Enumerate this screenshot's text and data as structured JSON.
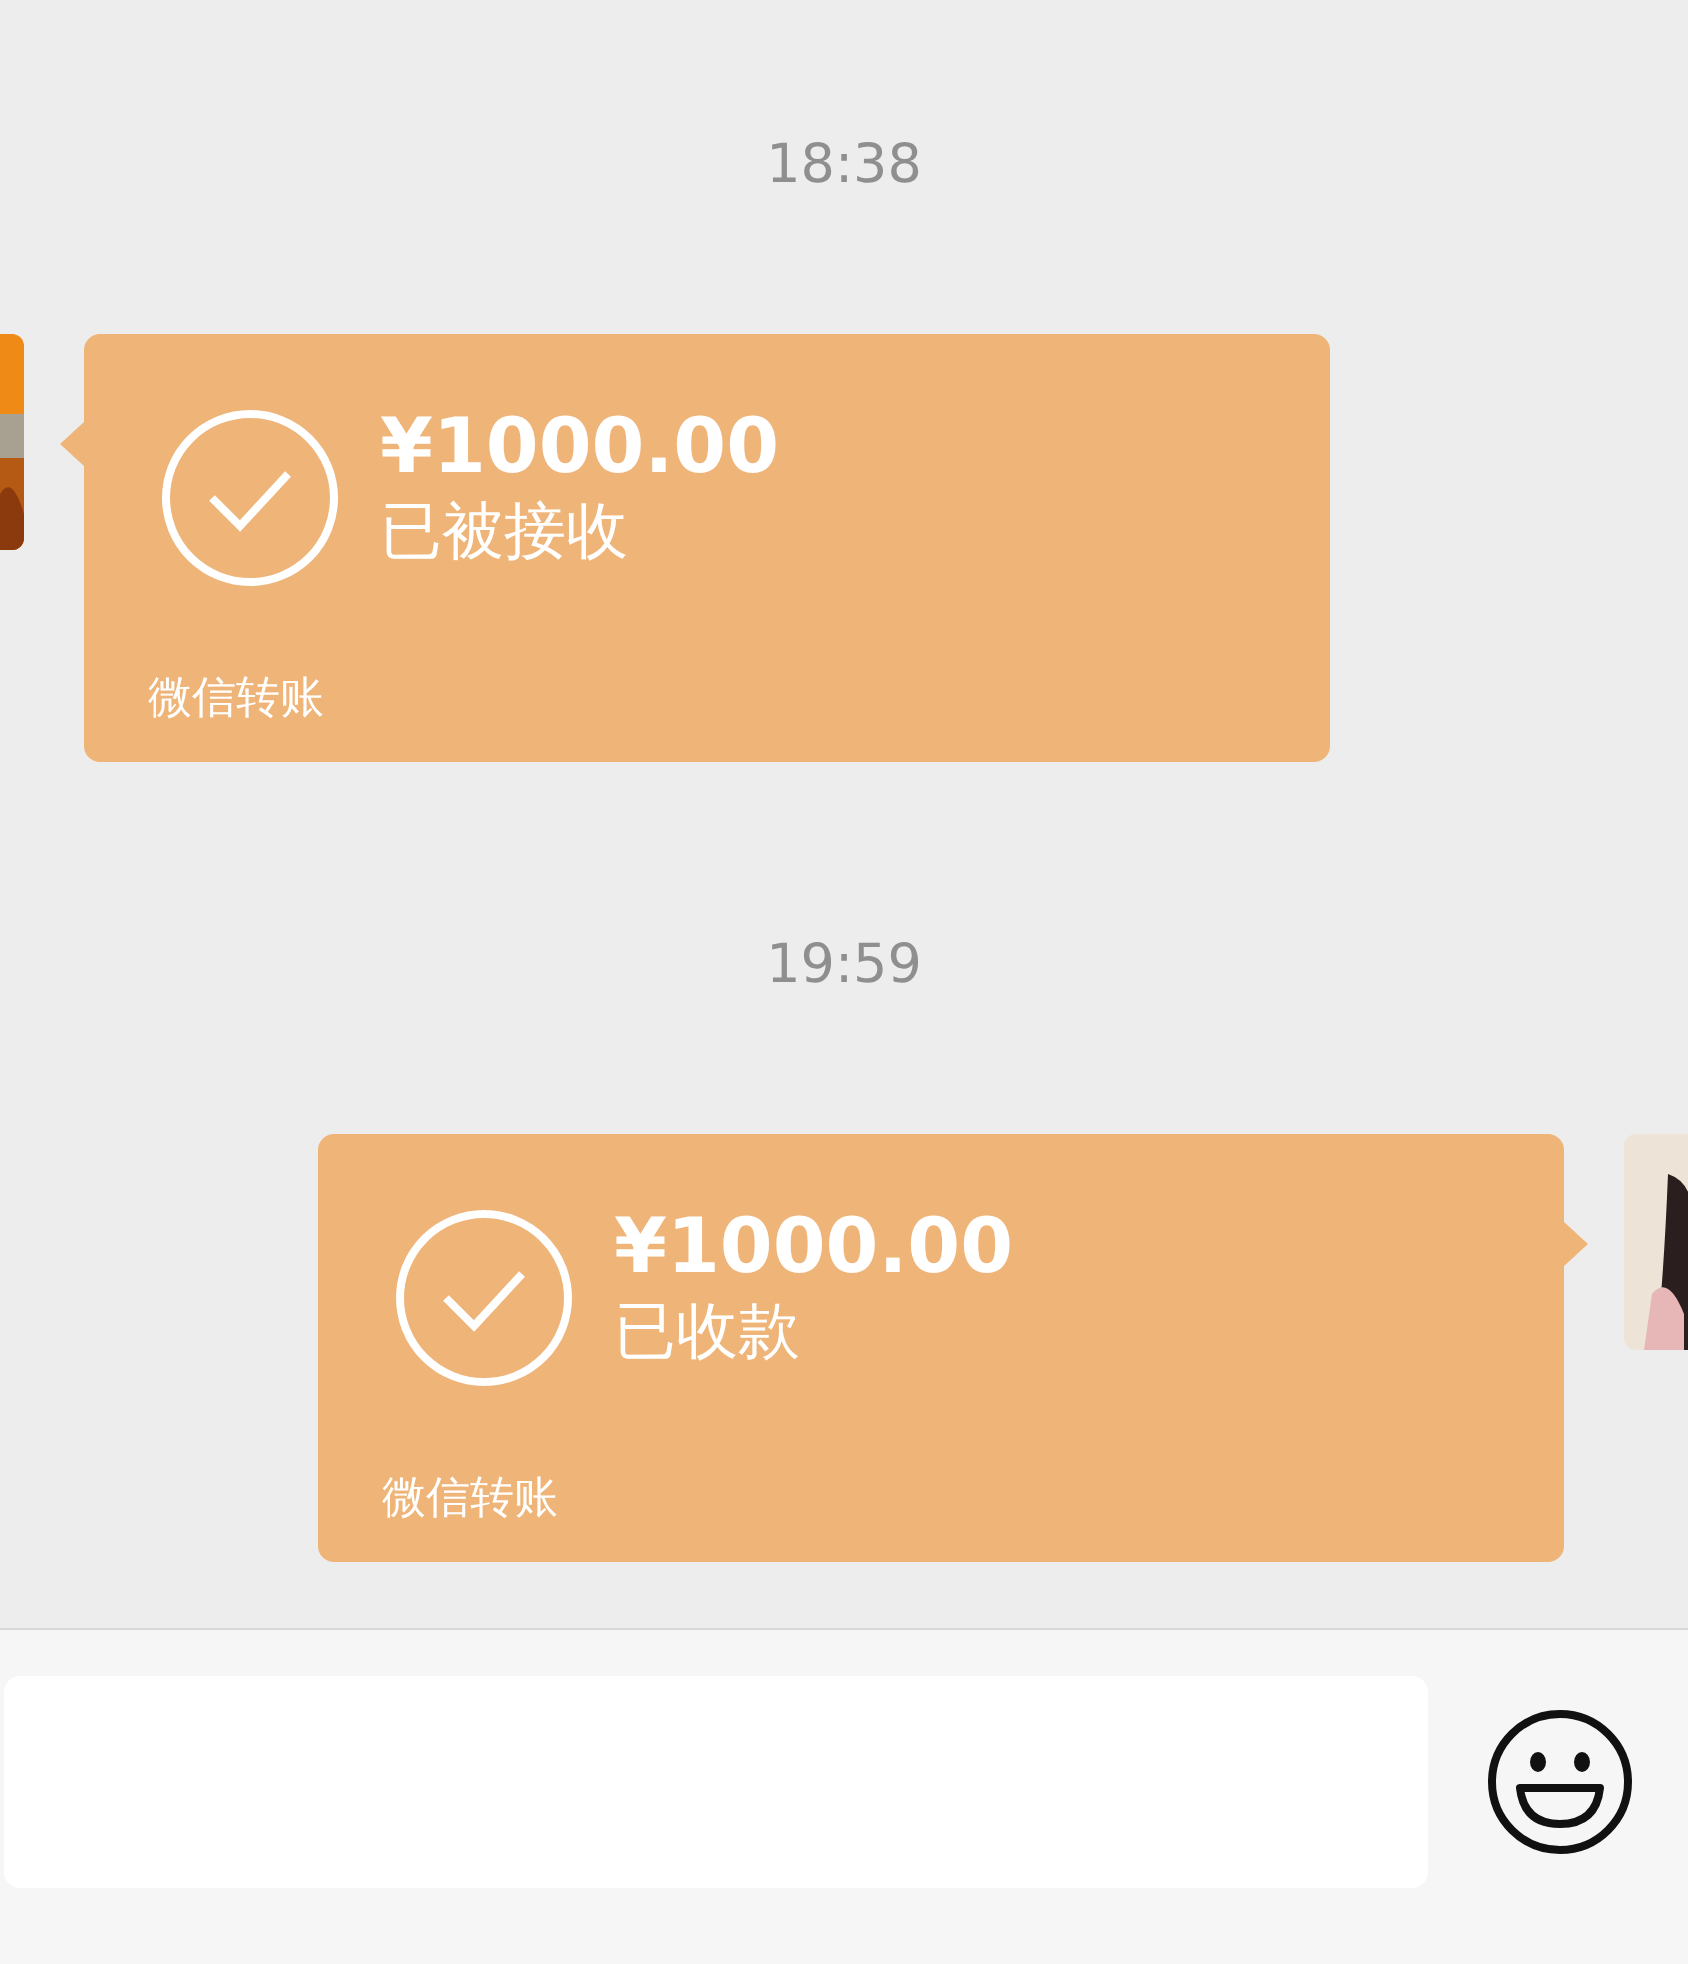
{
  "chat": [
    {
      "kind": "time",
      "text": "18:38"
    },
    {
      "kind": "incoming",
      "amount": "¥1000.00",
      "status": "已被接收",
      "footer": "微信转账"
    },
    {
      "kind": "time",
      "text": "19:59"
    },
    {
      "kind": "outgoing",
      "amount": "¥1000.00",
      "status": "已收款",
      "footer": "微信转账"
    }
  ]
}
